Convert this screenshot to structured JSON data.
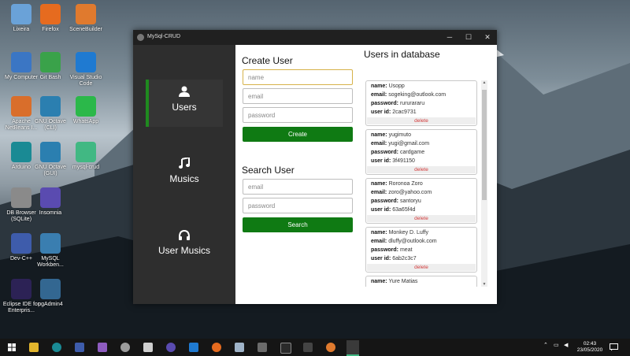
{
  "desktop": {
    "icons": [
      {
        "label": "Lixeira",
        "icon": "recycle-bin-icon",
        "color": "#6aa2d8"
      },
      {
        "label": "Firefox",
        "icon": "firefox-icon",
        "color": "#e66b1f"
      },
      {
        "label": "SceneBuilder",
        "icon": "scenebuilder-icon",
        "color": "#e07a2e"
      },
      {
        "label": "My Computer",
        "icon": "computer-icon",
        "color": "#3b76c4"
      },
      {
        "label": "Git Bash",
        "icon": "git-bash-icon",
        "color": "#3aa24a"
      },
      {
        "label": "Visual Studio Code",
        "icon": "vscode-icon",
        "color": "#1f7ad1"
      },
      {
        "label": "Apache NetBeans I...",
        "icon": "netbeans-icon",
        "color": "#d96e2b"
      },
      {
        "label": "GNU Octave (CLI)",
        "icon": "octave-icon",
        "color": "#2b7fb0"
      },
      {
        "label": "WhatsApp",
        "icon": "whatsapp-icon",
        "color": "#2bb84a"
      },
      {
        "label": "Arduino",
        "icon": "arduino-icon",
        "color": "#1a8a94"
      },
      {
        "label": "GNU Octave (GUI)",
        "icon": "octave-icon",
        "color": "#2b7fb0"
      },
      {
        "label": "mysql-crud",
        "icon": "vue-icon",
        "color": "#41b883"
      },
      {
        "label": "DB Browser (SQLite)",
        "icon": "db-browser-icon",
        "color": "#8a8a8a"
      },
      {
        "label": "Insomnia",
        "icon": "insomnia-icon",
        "color": "#5a4bb0"
      },
      {
        "label": "Dev-C++",
        "icon": "devcpp-icon",
        "color": "#3e5cab"
      },
      {
        "label": "MySQL Workben...",
        "icon": "mysql-workbench-icon",
        "color": "#3a7eb0"
      },
      {
        "label": "Eclipse IDE for Enterpris...",
        "icon": "eclipse-icon",
        "color": "#2c2255"
      },
      {
        "label": "pgAdmin4",
        "icon": "pgadmin-icon",
        "color": "#336791"
      }
    ]
  },
  "window": {
    "title": "MySql-CRUD",
    "minimize": "─",
    "maximize": "☐",
    "close": "✕"
  },
  "sidebar": {
    "items": [
      {
        "label": "Users",
        "icon": "user-icon"
      },
      {
        "label": "Musics",
        "icon": "music-note-icon"
      },
      {
        "label": "User Musics",
        "icon": "headphones-icon"
      }
    ],
    "accent": "#1f8a1f"
  },
  "create_user": {
    "heading": "Create User",
    "name_placeholder": "name",
    "email_placeholder": "email",
    "password_placeholder": "password",
    "button": "Create"
  },
  "search_user": {
    "heading": "Search User",
    "email_placeholder": "email",
    "password_placeholder": "password",
    "button": "Search"
  },
  "users_list": {
    "heading": "Users in database",
    "field_labels": {
      "name": "name:",
      "email": "email:",
      "password": "password:",
      "id": "user id:"
    },
    "delete_label": "delete",
    "users": [
      {
        "name": "Usopp",
        "email": "sogeking@outlook.com",
        "password": "rururararu",
        "id": "2cac9731"
      },
      {
        "name": "yugimuto",
        "email": "yugi@gmail.com",
        "password": "cardgame",
        "id": "3f491150"
      },
      {
        "name": "Roronoa Zoro",
        "email": "zoro@yahoo.com",
        "password": "santoryu",
        "id": "63a65f4d"
      },
      {
        "name": "Monkey D. Luffy",
        "email": "dluffy@outlook.com",
        "password": "meat",
        "id": "6ab2c3c7"
      },
      {
        "name": "Yure Matias",
        "email": "",
        "password": "",
        "id": ""
      }
    ]
  },
  "taskbar": {
    "time": "02:43",
    "date": "23/05/2020",
    "primary_green": "#0f7a13"
  }
}
